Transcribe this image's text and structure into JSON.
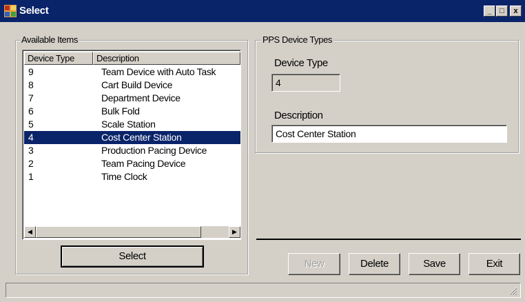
{
  "window": {
    "title": "Select"
  },
  "title_buttons": {
    "minimize": "_",
    "maximize": "□",
    "close": "x"
  },
  "available_items": {
    "legend": "Available Items",
    "columns": [
      "Device Type",
      "Description"
    ],
    "rows": [
      {
        "type": "9",
        "description": "Team Device with Auto Task"
      },
      {
        "type": "8",
        "description": "Cart Build Device"
      },
      {
        "type": "7",
        "description": "Department Device"
      },
      {
        "type": "6",
        "description": "Bulk Fold"
      },
      {
        "type": "5",
        "description": "Scale Station"
      },
      {
        "type": "4",
        "description": "Cost Center Station"
      },
      {
        "type": "3",
        "description": "Production Pacing Device"
      },
      {
        "type": "2",
        "description": "Team Pacing Device"
      },
      {
        "type": "1",
        "description": "Time Clock"
      }
    ],
    "selected_index": 5,
    "select_button": "Select"
  },
  "device_types": {
    "legend": "PPS Device Types",
    "device_type_label": "Device Type",
    "device_type_value": "4",
    "description_label": "Description",
    "description_value": "Cost Center Station"
  },
  "actions": {
    "new": "New",
    "delete": "Delete",
    "save": "Save",
    "exit": "Exit"
  },
  "colors": {
    "titlebar": "#0a246a",
    "selection": "#0a246a",
    "face": "#d4d0c8"
  }
}
